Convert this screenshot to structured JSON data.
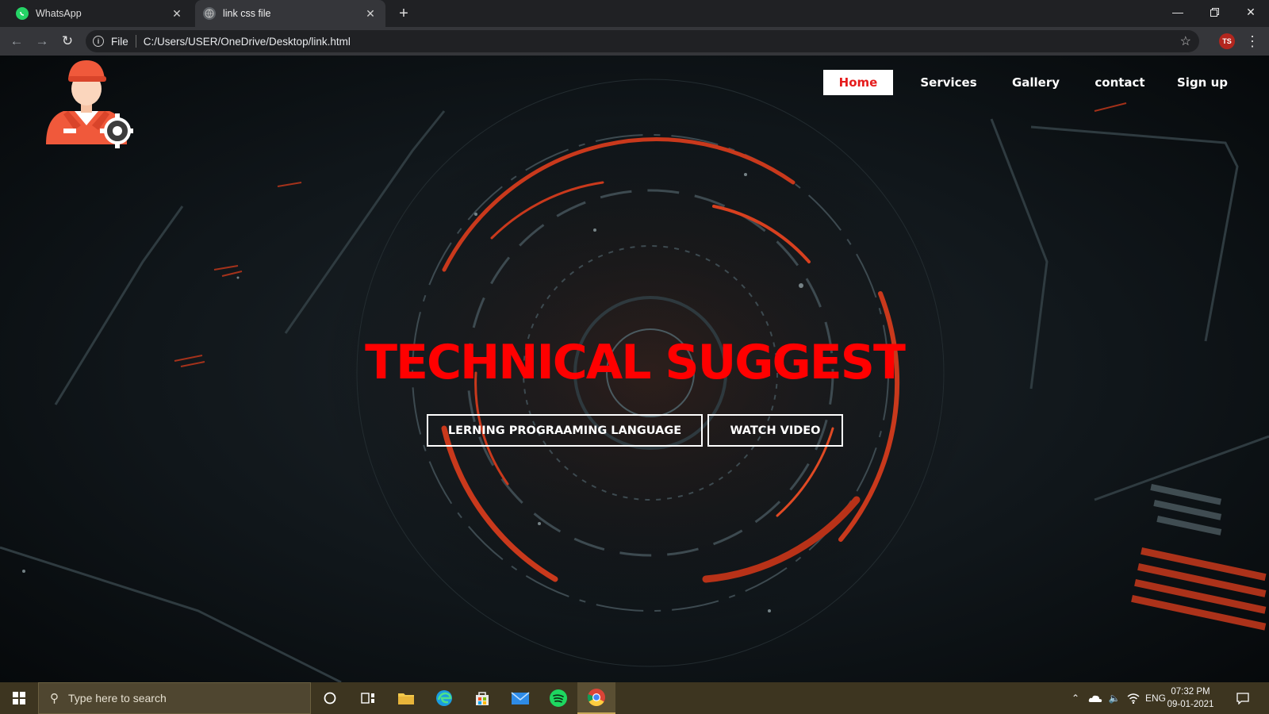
{
  "browser": {
    "tabs": [
      {
        "title": "WhatsApp",
        "icon": "whatsapp-icon",
        "active": false
      },
      {
        "title": "link css file",
        "icon": "globe-icon",
        "active": true
      }
    ],
    "address": {
      "scheme": "File",
      "url": "C:/Users/USER/OneDrive/Desktop/link.html"
    },
    "extension_badge": "TS"
  },
  "site": {
    "nav": [
      {
        "label": "Home",
        "active": true
      },
      {
        "label": "Services",
        "active": false
      },
      {
        "label": "Gallery",
        "active": false
      },
      {
        "label": "contact",
        "active": false
      },
      {
        "label": "Sign up",
        "active": false
      }
    ],
    "hero": {
      "title": "TECHNICAL SUGGEST",
      "buttons": [
        "LERNING PROGRAAMING LANGUAGE",
        "WATCH VIDEO"
      ]
    },
    "colors": {
      "accent": "#ff0000",
      "nav_active_text": "#e51c1c",
      "nav_active_bg": "#ffffff"
    }
  },
  "taskbar": {
    "search_placeholder": "Type here to search",
    "pinned": [
      "task-view-icon",
      "file-explorer-icon",
      "edge-icon",
      "store-icon",
      "mail-icon",
      "spotify-icon",
      "chrome-icon"
    ],
    "tray": {
      "language": "ENG",
      "time": "07:32 PM",
      "date": "09-01-2021"
    }
  }
}
